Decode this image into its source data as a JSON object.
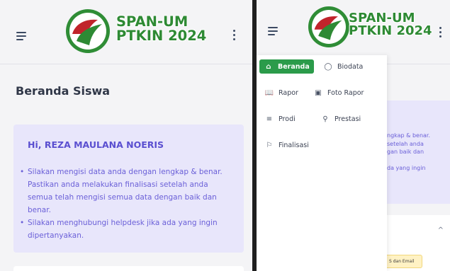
{
  "logo": {
    "line1": "SPAN-UM",
    "line2": "PTKIN 2024"
  },
  "icons": {
    "menu": "hamburger-icon",
    "more": "vertical-dots-icon"
  },
  "page": {
    "title": "Beranda Siswa"
  },
  "info": {
    "greeting": "Hi, REZA MAULANA NOERIS",
    "items": [
      "Silakan mengisi data anda dengan lengkap & benar. Pastikan anda melakukan finalisasi setelah anda semua telah mengisi semua data dengan baik dan benar.",
      "Silakan menghubungi helpdesk jika ada yang ingin dipertanyakan."
    ]
  },
  "right_bg": {
    "card_text": "ngkap & benar.\nsetelah anda\ngan baik dan\n\nda yang ingin",
    "badge_text": "S dan Email"
  },
  "nav": {
    "items": [
      {
        "label": "Beranda",
        "icon": "home-icon",
        "active": true
      },
      {
        "label": "Biodata",
        "icon": "user-icon",
        "active": false
      },
      {
        "label": "Rapor",
        "icon": "book-icon",
        "active": false
      },
      {
        "label": "Foto Rapor",
        "icon": "camera-icon",
        "active": false
      },
      {
        "label": "Prodi",
        "icon": "list-icon",
        "active": false
      },
      {
        "label": "Prestasi",
        "icon": "award-icon",
        "active": false
      },
      {
        "label": "Finalisasi",
        "icon": "flag-icon",
        "active": false
      }
    ]
  },
  "colors": {
    "brand_green": "#2e8a34",
    "active_green": "#2b9b4a",
    "info_bg": "#e8e6fb",
    "info_text": "#6b60d8",
    "info_heading": "#5a4fd0"
  }
}
